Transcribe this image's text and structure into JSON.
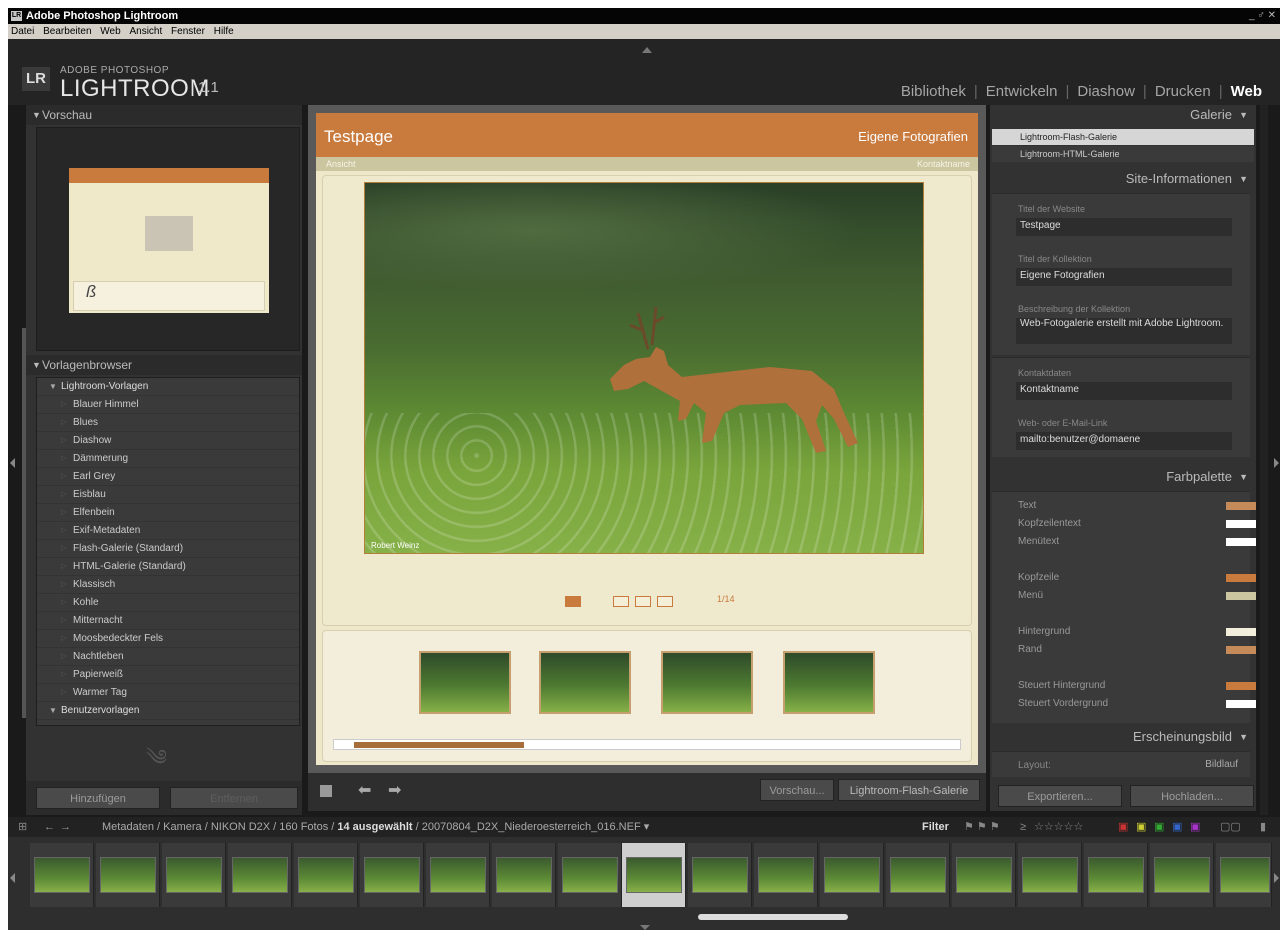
{
  "window": {
    "title": "Adobe Photoshop Lightroom",
    "controls": "_ ♂ ✕"
  },
  "app_icon": "LR",
  "menu": [
    "Datei",
    "Bearbeiten",
    "Web",
    "Ansicht",
    "Fenster",
    "Hilfe"
  ],
  "identity": {
    "badge": "LR",
    "line1": "ADOBE PHOTOSHOP",
    "line2": "LIGHTROOM",
    "version": "1.1"
  },
  "modules": [
    "Bibliothek",
    "Entwickeln",
    "Diashow",
    "Drucken",
    "Web"
  ],
  "module_separator": "|",
  "left": {
    "vorschau_title": "Vorschau",
    "preview_glyph": "ß",
    "browser_title": "Vorlagenbrowser",
    "group1": "Lightroom-Vorlagen",
    "templates": [
      "Blauer Himmel",
      "Blues",
      "Diashow",
      "Dämmerung",
      "Earl Grey",
      "Eisblau",
      "Elfenbein",
      "Exif-Metadaten",
      "Flash-Galerie (Standard)",
      "HTML-Galerie (Standard)",
      "Klassisch",
      "Kohle",
      "Mitternacht",
      "Moosbedeckter Fels",
      "Nachtleben",
      "Papierweiß",
      "Warmer Tag"
    ],
    "group2": "Benutzervorlagen",
    "add_button": "Hinzufügen",
    "remove_button": "Entfernen"
  },
  "page": {
    "title": "Testpage",
    "collection": "Eigene Fotografien",
    "nav_left": "Ansicht",
    "nav_right": "Kontaktname",
    "photo_credit": "Robert Weinz",
    "counter": "1/14"
  },
  "center_bar": {
    "preview_button": "Vorschau...",
    "gallery_button": "Lightroom-Flash-Galerie"
  },
  "right": {
    "galerie_title": "Galerie",
    "galleries": [
      "Lightroom-Flash-Galerie",
      "Lightroom-HTML-Galerie"
    ],
    "site_info_title": "Site-Informationen",
    "fields": [
      {
        "label": "Titel der Website",
        "value": "Testpage"
      },
      {
        "label": "Titel der Kollektion",
        "value": "Eigene Fotografien"
      },
      {
        "label": "Beschreibung der Kollektion",
        "value": "Web-Fotogalerie erstellt mit Adobe Lightroom."
      },
      {
        "label": "Kontaktdaten",
        "value": "Kontaktname"
      },
      {
        "label": "Web- oder E-Mail-Link",
        "value": "mailto:benutzer@domaene"
      }
    ],
    "palette_title": "Farbpalette",
    "colors": [
      {
        "label": "Text",
        "color": "#c48a5a"
      },
      {
        "label": "Kopfzeilentext",
        "color": "#ffffff"
      },
      {
        "label": "Menütext",
        "color": "#ffffff"
      },
      {
        "label": "Kopfzeile",
        "color": "#c97a3d"
      },
      {
        "label": "Menü",
        "color": "#cbc6a0"
      },
      {
        "label": "Hintergrund",
        "color": "#f3eddb"
      },
      {
        "label": "Rand",
        "color": "#c48a5a"
      },
      {
        "label": "Steuert Hintergrund",
        "color": "#c97a3d"
      },
      {
        "label": "Steuert Vordergrund",
        "color": "#ffffff"
      }
    ],
    "appearance_title": "Erscheinungsbild",
    "layout_label": "Layout:",
    "layout_value": "Bildlauf",
    "export_button": "Exportieren...",
    "upload_button": "Hochladen..."
  },
  "filmstrip": {
    "path": "Metadaten / Kamera / NIKON D2X / 160 Fotos / ",
    "selected": "14 ausgewählt",
    "filename": " / 20070804_D2X_Niederoesterreich_016.NEF",
    "filter_label": "Filter",
    "rating_op": "≥",
    "stars": "☆☆☆☆☆"
  }
}
